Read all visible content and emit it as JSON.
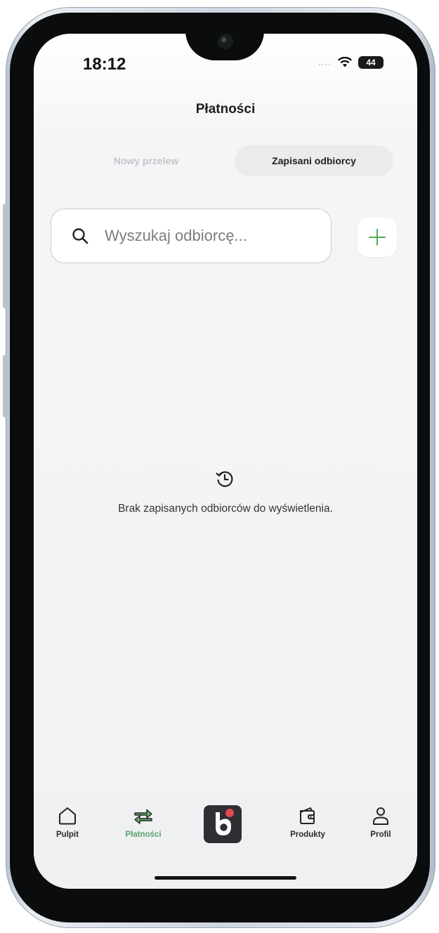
{
  "status_bar": {
    "time": "18:12",
    "signal_dots": "....",
    "battery": "44"
  },
  "header": {
    "title": "Płatności"
  },
  "tabs": [
    {
      "label": "Nowy przelew",
      "active": false
    },
    {
      "label": "Zapisani odbiorcy",
      "active": true
    }
  ],
  "search": {
    "placeholder": "Wyszukaj odbiorcę...",
    "value": ""
  },
  "add_button": {
    "icon": "plus-icon"
  },
  "empty_state": {
    "icon": "history-icon",
    "text": "Brak zapisanych odbiorców do wyświetlenia."
  },
  "bottom_nav": {
    "items": [
      {
        "label": "Pulpit",
        "icon": "home-icon",
        "active": false
      },
      {
        "label": "Płatności",
        "icon": "transfer-arrows-icon",
        "active": true
      },
      {
        "label": "",
        "icon": "brand-logo-icon",
        "active": false
      },
      {
        "label": "Produkty",
        "icon": "wallet-icon",
        "active": false
      },
      {
        "label": "Profil",
        "icon": "user-icon",
        "active": false
      }
    ]
  },
  "colors": {
    "accent": "#4caf50",
    "active_label": "#58a36b",
    "brand_dot": "#e5484d",
    "screen_bg": "#f1f2f3"
  }
}
